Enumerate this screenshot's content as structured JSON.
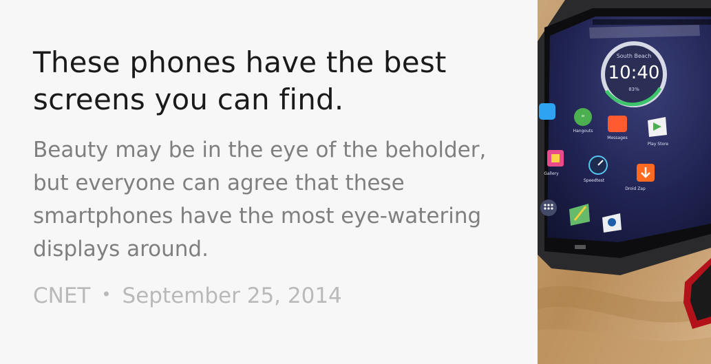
{
  "article": {
    "title": "These phones have the best screens you can find.",
    "snippet": "Beauty may be in the eye of the beholder, but everyone can agree that these smartphones have the most eye-watering displays around.",
    "source": "CNET",
    "separator": "•",
    "date": "September 25, 2014"
  },
  "thumbnail": {
    "phone_clock": "10:40",
    "phone_location": "South Beach",
    "phone_battery": "83%",
    "app_labels": [
      "Hangouts",
      "Messages",
      "Play Store",
      "Gallery",
      "Speedtest",
      "Droid Zap"
    ]
  }
}
